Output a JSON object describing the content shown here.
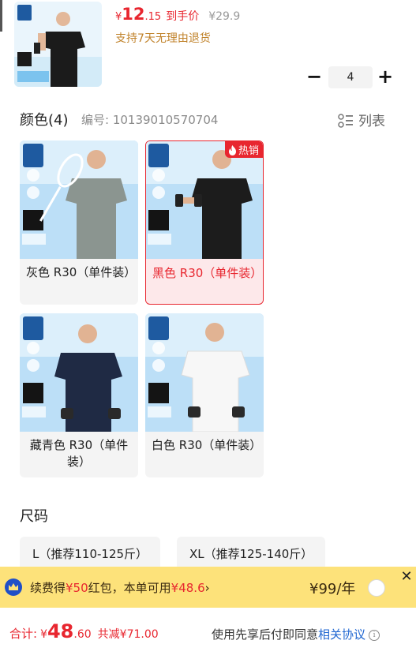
{
  "product": {
    "price_symbol": "¥",
    "price_integer": "12",
    "price_decimal": ".15",
    "price_tag": "到手价",
    "original_price": "¥29.9",
    "return_policy": "支持7天无理由退货",
    "quantity": "4"
  },
  "color_section": {
    "title": "颜色(4)",
    "code": "编号: 10139010570704",
    "view_toggle": "列表",
    "variants": [
      {
        "label": "灰色 R30（单件装）",
        "shirt_color": "#8b9590",
        "selected": false,
        "badge": ""
      },
      {
        "label": "黑色 R30（单件装）",
        "shirt_color": "#1c1c1c",
        "selected": true,
        "badge": "热销"
      },
      {
        "label": "藏青色 R30（单件装）",
        "shirt_color": "#1f2a44",
        "selected": false,
        "badge": ""
      },
      {
        "label": "白色 R30（单件装）",
        "shirt_color": "#f7f7f7",
        "selected": false,
        "badge": ""
      }
    ]
  },
  "size_section": {
    "title": "尺码",
    "options": [
      "L（推荐110-125斤）",
      "XL（推荐125-140斤）"
    ]
  },
  "promo": {
    "text_a": "续费得",
    "amount_a": "¥50",
    "text_b": "红包，本单可用",
    "amount_b": "¥48.6",
    "arrow": "›",
    "price": "¥99/年"
  },
  "bottom_bar": {
    "total_label": "合计:",
    "total_symbol": "¥",
    "total_integer": "48",
    "total_decimal": ".60",
    "saving": "共减¥71.00",
    "agreement_text": "使用先享后付即同意",
    "agreement_link": "相关协议"
  },
  "colors": {
    "accent_red": "#e8262f",
    "promo_bg": "#fde27a",
    "link_blue": "#1f66d1",
    "gold_text": "#c0822a"
  }
}
